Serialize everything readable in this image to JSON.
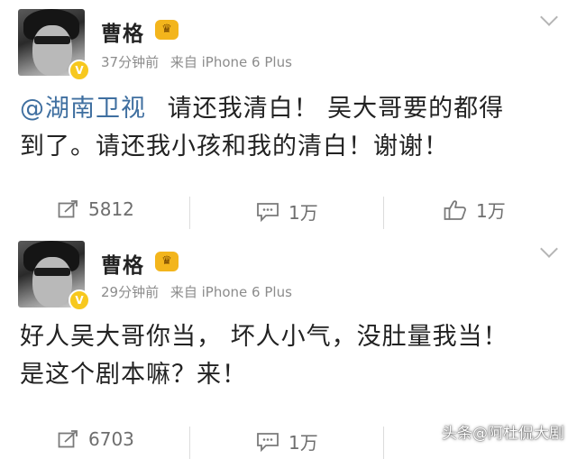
{
  "posts": [
    {
      "username": "曹格",
      "verified_badge": "V",
      "time": "37分钟前",
      "source": "来自 iPhone 6 Plus",
      "body_mention": "@湖南卫视",
      "body_line1": "请还我清白！ 吴大哥要的都得",
      "body_line2": "到了。请还我小孩和我的清白！谢谢！",
      "repost_count": "5812",
      "comment_count": "1万",
      "like_count": "1万"
    },
    {
      "username": "曹格",
      "verified_badge": "V",
      "time": "29分钟前",
      "source": "来自 iPhone 6 Plus",
      "body_line1": "好人吴大哥你当， 坏人小气，没肚量我当！",
      "body_line2": "是这个剧本嘛？来！",
      "repost_count": "6703",
      "comment_count": "1万"
    }
  ],
  "watermark": "头条@阿杜侃大剧",
  "icons": {
    "repost": "share-icon",
    "comment": "comment-icon",
    "like": "thumbs-up-icon",
    "menu": "chevron-down-icon",
    "vip": "crown-icon"
  },
  "colors": {
    "mention": "#3f6fa0",
    "verified": "#f7c81e",
    "crown": "#f3b51c",
    "meta_text": "#8c8c8c"
  }
}
